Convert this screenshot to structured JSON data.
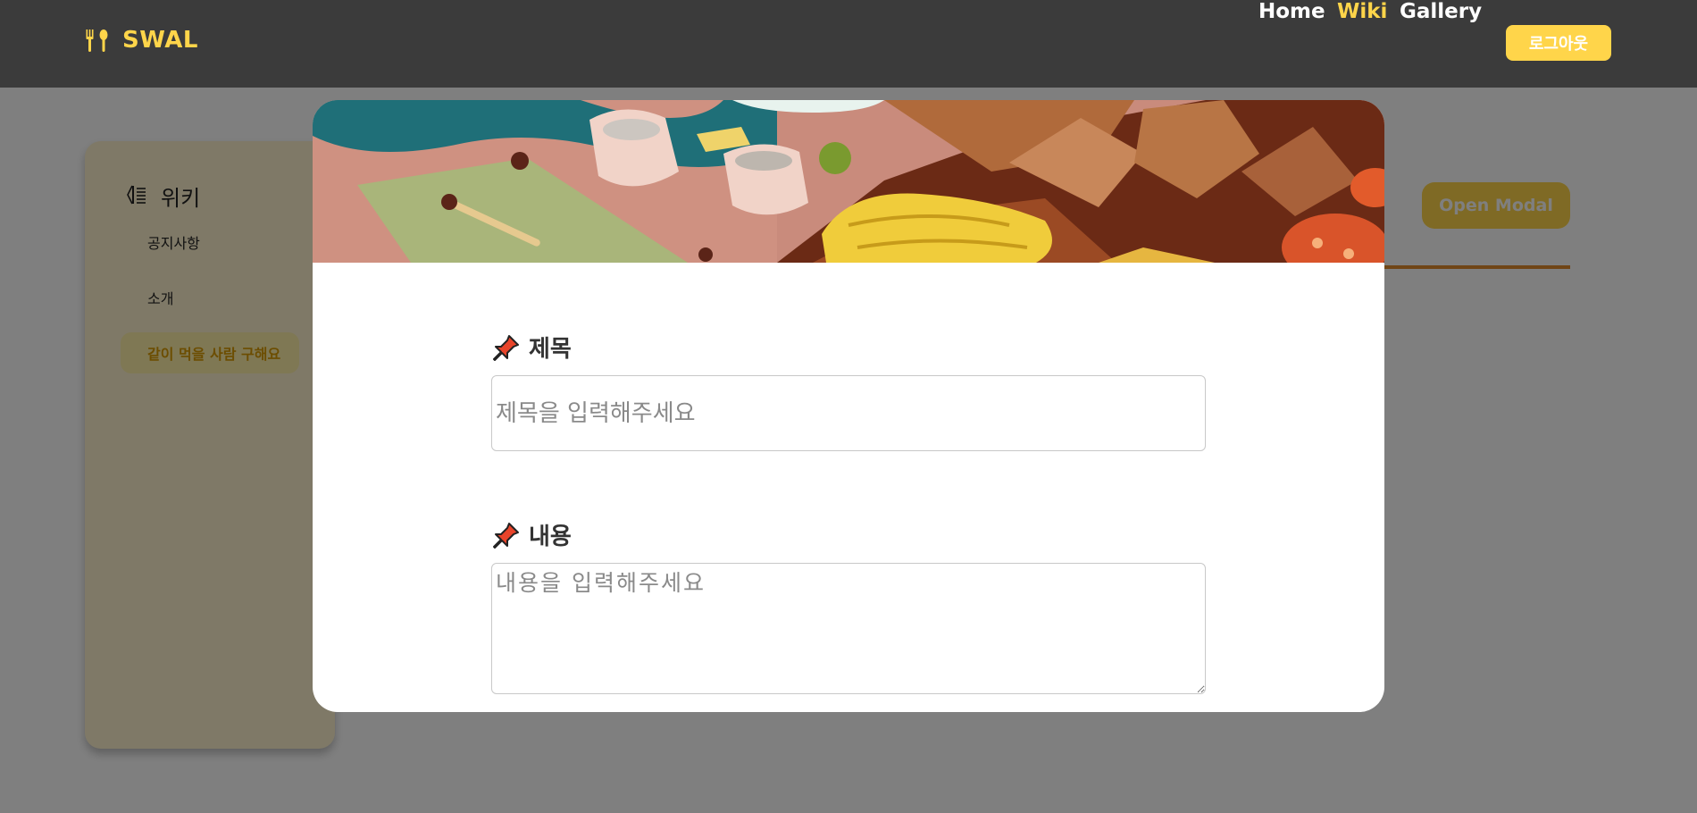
{
  "navbar": {
    "brand": "SWAL",
    "links": [
      {
        "label": "Home",
        "active": false
      },
      {
        "label": "Wiki",
        "active": true
      },
      {
        "label": "Gallery",
        "active": false
      }
    ],
    "logout_label": "로그아웃"
  },
  "sidebar": {
    "title": "위키",
    "items": [
      {
        "label": "공지사항",
        "active": false
      },
      {
        "label": "소개",
        "active": false
      },
      {
        "label": "같이 먹을 사람 구해요",
        "active": true
      }
    ]
  },
  "main": {
    "open_modal_label": "Open Modal"
  },
  "modal": {
    "title_label": "제목",
    "title_placeholder": "제목을 입력해주세요",
    "content_label": "내용",
    "content_placeholder": "내용을 입력해주세요"
  },
  "colors": {
    "navbar_bg": "#3b3b3b",
    "accent_yellow": "#ffd54a",
    "sidebar_bg": "#fff3cf",
    "rule_orange": "#e08a2c"
  },
  "icons": {
    "brand": "fork-spoon-icon",
    "sidebar": "wiki-book-icon",
    "label": "pushpin-icon"
  }
}
